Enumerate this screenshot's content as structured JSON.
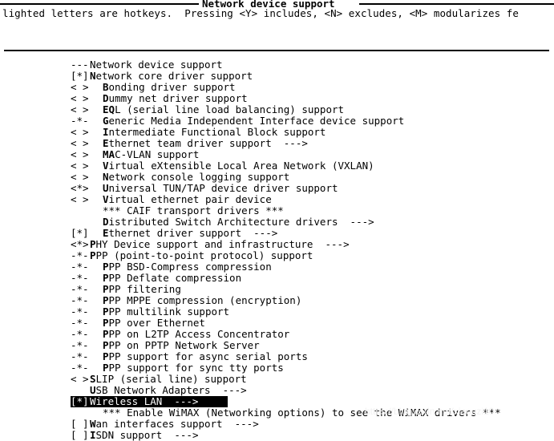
{
  "window": {
    "title": "Network device support"
  },
  "help": {
    "text": "lighted letters are hotkeys.  Pressing <Y> includes, <N> excludes, <M> modularizes fe"
  },
  "watermark": {
    "text": "https://blog.csdn.net/xiaoqzi10"
  },
  "menu": {
    "rows": [
      {
        "marker": "---",
        "label": "Network device support",
        "indent": 0,
        "selected": false,
        "hotkey": 0,
        "type": "section"
      },
      {
        "marker": "[*]",
        "label": "Network core driver support",
        "indent": 0,
        "selected": false,
        "hotkey": 1,
        "type": "bool"
      },
      {
        "marker": "< >",
        "label": "Bonding driver support",
        "indent": 1,
        "selected": false,
        "hotkey": 1,
        "type": "tristate"
      },
      {
        "marker": "< >",
        "label": "Dummy net driver support",
        "indent": 1,
        "selected": false,
        "hotkey": 1,
        "type": "tristate"
      },
      {
        "marker": "< >",
        "label": "EQL (serial line load balancing) support",
        "indent": 1,
        "selected": false,
        "hotkey": 2,
        "type": "tristate"
      },
      {
        "marker": "-*-",
        "label": "Generic Media Independent Interface device support",
        "indent": 1,
        "selected": false,
        "hotkey": 1,
        "type": "tristate"
      },
      {
        "marker": "< >",
        "label": "Intermediate Functional Block support",
        "indent": 1,
        "selected": false,
        "hotkey": 1,
        "type": "tristate"
      },
      {
        "marker": "< >",
        "label": "Ethernet team driver support  --->",
        "indent": 1,
        "selected": false,
        "hotkey": 1,
        "type": "tristate"
      },
      {
        "marker": "< >",
        "label": "MAC-VLAN support",
        "indent": 1,
        "selected": false,
        "hotkey": 2,
        "type": "tristate"
      },
      {
        "marker": "< >",
        "label": "Virtual eXtensible Local Area Network (VXLAN)",
        "indent": 1,
        "selected": false,
        "hotkey": 1,
        "type": "tristate"
      },
      {
        "marker": "< >",
        "label": "Network console logging support",
        "indent": 1,
        "selected": false,
        "hotkey": 1,
        "type": "tristate"
      },
      {
        "marker": "<*>",
        "label": "Universal TUN/TAP device driver support",
        "indent": 1,
        "selected": false,
        "hotkey": 1,
        "type": "tristate"
      },
      {
        "marker": "< >",
        "label": "Virtual ethernet pair device",
        "indent": 1,
        "selected": false,
        "hotkey": 1,
        "type": "tristate"
      },
      {
        "marker": "",
        "label": "*** CAIF transport drivers ***",
        "indent": 1,
        "selected": false,
        "hotkey": 0,
        "type": "comment"
      },
      {
        "marker": "",
        "label": "Distributed Switch Architecture drivers  --->",
        "indent": 1,
        "selected": false,
        "hotkey": 1,
        "type": "menu"
      },
      {
        "marker": "[*]",
        "label": "Ethernet driver support  --->",
        "indent": 1,
        "selected": false,
        "hotkey": 1,
        "type": "menu"
      },
      {
        "marker": "<*>",
        "label": "PHY Device support and infrastructure  --->",
        "indent": 0,
        "selected": false,
        "hotkey": 1,
        "type": "menu"
      },
      {
        "marker": "-*-",
        "label": "PPP (point-to-point protocol) support",
        "indent": 0,
        "selected": false,
        "hotkey": 1,
        "type": "tristate"
      },
      {
        "marker": "-*-",
        "label": "PPP BSD-Compress compression",
        "indent": 1,
        "selected": false,
        "hotkey": 1,
        "type": "tristate"
      },
      {
        "marker": "-*-",
        "label": "PPP Deflate compression",
        "indent": 1,
        "selected": false,
        "hotkey": 1,
        "type": "tristate"
      },
      {
        "marker": "-*-",
        "label": "PPP filtering",
        "indent": 1,
        "selected": false,
        "hotkey": 1,
        "type": "tristate"
      },
      {
        "marker": "-*-",
        "label": "PPP MPPE compression (encryption)",
        "indent": 1,
        "selected": false,
        "hotkey": 1,
        "type": "tristate"
      },
      {
        "marker": "-*-",
        "label": "PPP multilink support",
        "indent": 1,
        "selected": false,
        "hotkey": 1,
        "type": "tristate"
      },
      {
        "marker": "-*-",
        "label": "PPP over Ethernet",
        "indent": 1,
        "selected": false,
        "hotkey": 1,
        "type": "tristate"
      },
      {
        "marker": "-*-",
        "label": "PPP on L2TP Access Concentrator",
        "indent": 1,
        "selected": false,
        "hotkey": 1,
        "type": "tristate"
      },
      {
        "marker": "-*-",
        "label": "PPP on PPTP Network Server",
        "indent": 1,
        "selected": false,
        "hotkey": 1,
        "type": "tristate"
      },
      {
        "marker": "-*-",
        "label": "PPP support for async serial ports",
        "indent": 1,
        "selected": false,
        "hotkey": 1,
        "type": "tristate"
      },
      {
        "marker": "-*-",
        "label": "PPP support for sync tty ports",
        "indent": 1,
        "selected": false,
        "hotkey": 1,
        "type": "tristate"
      },
      {
        "marker": "< >",
        "label": "SLIP (serial line) support",
        "indent": 0,
        "selected": false,
        "hotkey": 1,
        "type": "tristate"
      },
      {
        "marker": "",
        "label": "USB Network Adapters  --->",
        "indent": 0,
        "selected": false,
        "hotkey": 1,
        "type": "menu"
      },
      {
        "marker": "[*]",
        "label": "Wireless LAN  --->",
        "indent": 0,
        "selected": true,
        "hotkey": 0,
        "type": "menu"
      },
      {
        "marker": "",
        "label": "*** Enable WiMAX (Networking options) to see the WiMAX drivers ***",
        "indent": 1,
        "selected": false,
        "hotkey": 0,
        "type": "comment"
      },
      {
        "marker": "[ ]",
        "label": "Wan interfaces support  --->",
        "indent": 0,
        "selected": false,
        "hotkey": 1,
        "type": "menu"
      },
      {
        "marker": "[ ]",
        "label": "ISDN support  --->",
        "indent": 0,
        "selected": false,
        "hotkey": 1,
        "type": "menu"
      }
    ]
  }
}
